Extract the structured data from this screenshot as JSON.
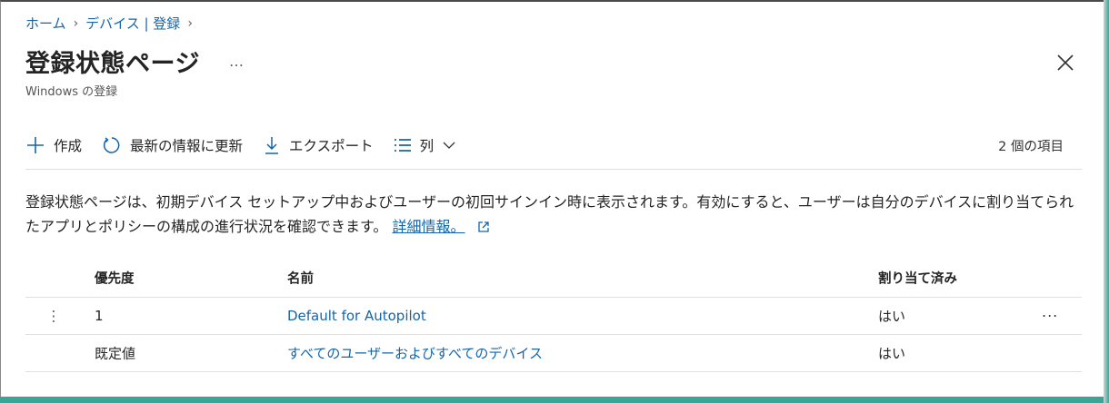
{
  "breadcrumb": [
    {
      "label": "ホーム"
    },
    {
      "label": "デバイス | 登録"
    }
  ],
  "page": {
    "title": "登録状態ページ",
    "more": "…",
    "subtitle": "Windows の登録"
  },
  "toolbar": {
    "create": "作成",
    "refresh": "最新の情報に更新",
    "export": "エクスポート",
    "columns": "列",
    "item_count": "2 個の項目"
  },
  "description": {
    "text": "登録状態ページは、初期デバイス セットアップ中およびユーザーの初回サインイン時に表示されます。有効にすると、ユーザーは自分のデバイスに割り当てられたアプリとポリシーの構成の進行状況を確認できます。",
    "link": "詳細情報。"
  },
  "table": {
    "columns": {
      "priority": "優先度",
      "name": "名前",
      "assigned": "割り当て済み"
    },
    "rows": [
      {
        "drag": "⋮",
        "priority": "1",
        "name": "Default for Autopilot",
        "assigned": "はい",
        "more": "···"
      },
      {
        "drag": "",
        "priority": "既定値",
        "name": "すべてのユーザーおよびすべてのデバイス",
        "assigned": "はい",
        "more": ""
      }
    ]
  },
  "colors": {
    "link": "#1565a8",
    "accent_border": "#3aa596"
  }
}
